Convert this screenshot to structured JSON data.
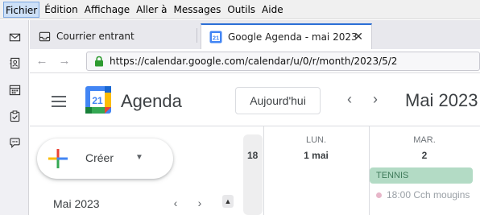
{
  "menu": {
    "items": [
      "Fichier",
      "Édition",
      "Affichage",
      "Aller à",
      "Messages",
      "Outils",
      "Aide"
    ]
  },
  "spaces": {
    "icons": [
      "mail-icon",
      "address-book-icon",
      "calendar-icon",
      "tasks-icon",
      "chat-icon"
    ]
  },
  "tabs": [
    {
      "label": "Courrier entrant",
      "icon": "inbox-icon",
      "active": false
    },
    {
      "label": "Google Agenda - mai 2023",
      "icon": "google-calendar-icon",
      "active": true,
      "close": "✕"
    }
  ],
  "nav": {
    "back": "←",
    "forward": "→",
    "url": "https://calendar.google.com/calendar/u/0/r/month/2023/5/2"
  },
  "calendar": {
    "app_name": "Agenda",
    "logo_number": "21",
    "today_label": "Aujourd'hui",
    "prev": "‹",
    "next": "›",
    "month_title": "Mai 2023",
    "create_label": "Créer",
    "mini_month_title": "Mai 2023",
    "mini_prev": "‹",
    "mini_next": "›",
    "week_number": "18",
    "days": [
      {
        "name": "LUN.",
        "number": "1 mai"
      },
      {
        "name": "MAR.",
        "number": "2"
      }
    ],
    "events": [
      {
        "title": "TENNIS",
        "color": "#b3dbc5"
      },
      {
        "title": "18:00 Cch mougins",
        "color": "#e7b6c9"
      }
    ]
  },
  "colors": {
    "accent": "#2b6fd6",
    "lock_green": "#2e9b30",
    "google_blue": "#4285f4",
    "google_red": "#ea4335",
    "google_yellow": "#fbbc04",
    "google_green": "#34a853"
  }
}
